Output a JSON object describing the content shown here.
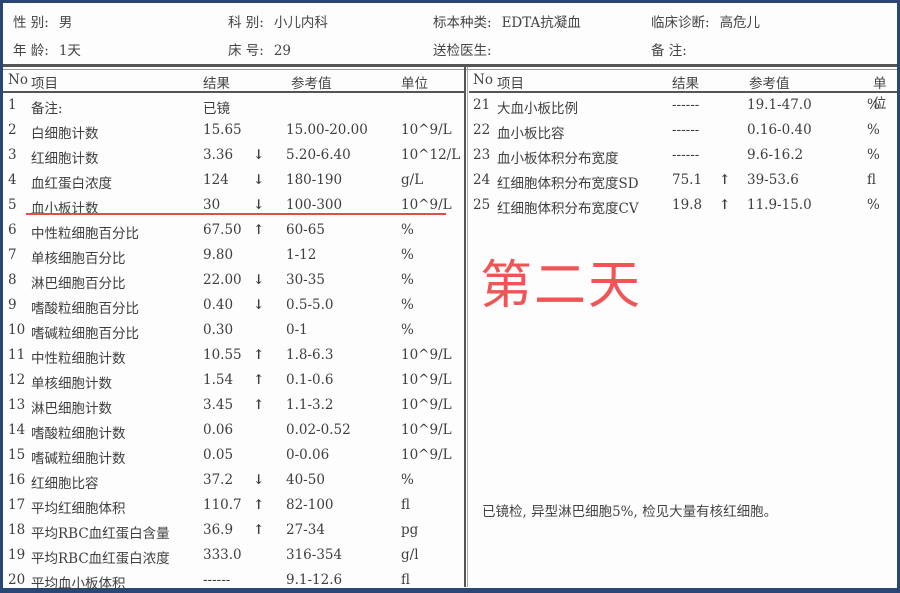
{
  "header": {
    "row1": [
      {
        "label": "性  别:",
        "value": "男"
      },
      {
        "label": "科  别:",
        "value": "小儿内科"
      },
      {
        "label": "标本种类:",
        "value": "EDTA抗凝血"
      },
      {
        "label": "临床诊断:",
        "value": "高危儿"
      }
    ],
    "row2": [
      {
        "label": "年  龄:",
        "value": "1天"
      },
      {
        "label": "床  号:",
        "value": "29"
      },
      {
        "label": "送检医生:",
        "value": ""
      },
      {
        "label": "备    注:",
        "value": ""
      }
    ]
  },
  "columns": {
    "no": "No",
    "name": "项目",
    "result": "结果",
    "reference": "参考值",
    "unit": "单位"
  },
  "left_rows": [
    {
      "no": "1",
      "name": "备注:",
      "result": "已镜",
      "flag": "",
      "reference": "",
      "unit": ""
    },
    {
      "no": "2",
      "name": "白细胞计数",
      "result": "15.65",
      "flag": "",
      "reference": "15.00-20.00",
      "unit": "10^9/L"
    },
    {
      "no": "3",
      "name": "红细胞计数",
      "result": "3.36",
      "flag": "↓",
      "reference": "5.20-6.40",
      "unit": "10^12/L"
    },
    {
      "no": "4",
      "name": "血红蛋白浓度",
      "result": "124",
      "flag": "↓",
      "reference": "180-190",
      "unit": "g/L"
    },
    {
      "no": "5",
      "name": "血小板计数",
      "result": "30",
      "flag": "↓",
      "reference": "100-300",
      "unit": "10^9/L"
    },
    {
      "no": "6",
      "name": "中性粒细胞百分比",
      "result": "67.50",
      "flag": "↑",
      "reference": "60-65",
      "unit": "%"
    },
    {
      "no": "7",
      "name": "单核细胞百分比",
      "result": "9.80",
      "flag": "",
      "reference": "1-12",
      "unit": "%"
    },
    {
      "no": "8",
      "name": "淋巴细胞百分比",
      "result": "22.00",
      "flag": "↓",
      "reference": "30-35",
      "unit": "%"
    },
    {
      "no": "9",
      "name": "嗜酸粒细胞百分比",
      "result": "0.40",
      "flag": "↓",
      "reference": "0.5-5.0",
      "unit": "%"
    },
    {
      "no": "10",
      "name": "嗜碱粒细胞百分比",
      "result": "0.30",
      "flag": "",
      "reference": "0-1",
      "unit": "%"
    },
    {
      "no": "11",
      "name": "中性粒细胞计数",
      "result": "10.55",
      "flag": "↑",
      "reference": "1.8-6.3",
      "unit": "10^9/L"
    },
    {
      "no": "12",
      "name": "单核细胞计数",
      "result": "1.54",
      "flag": "↑",
      "reference": "0.1-0.6",
      "unit": "10^9/L"
    },
    {
      "no": "13",
      "name": "淋巴细胞计数",
      "result": "3.45",
      "flag": "↑",
      "reference": "1.1-3.2",
      "unit": "10^9/L"
    },
    {
      "no": "14",
      "name": "嗜酸粒细胞计数",
      "result": "0.06",
      "flag": "",
      "reference": "0.02-0.52",
      "unit": "10^9/L"
    },
    {
      "no": "15",
      "name": "嗜碱粒细胞计数",
      "result": "0.05",
      "flag": "",
      "reference": "0-0.06",
      "unit": "10^9/L"
    },
    {
      "no": "16",
      "name": "红细胞比容",
      "result": "37.2",
      "flag": "↓",
      "reference": "40-50",
      "unit": "%"
    },
    {
      "no": "17",
      "name": "平均红细胞体积",
      "result": "110.7",
      "flag": "↑",
      "reference": "82-100",
      "unit": "fl"
    },
    {
      "no": "18",
      "name": "平均RBC血红蛋白含量",
      "result": "36.9",
      "flag": "↑",
      "reference": "27-34",
      "unit": "pg"
    },
    {
      "no": "19",
      "name": "平均RBC血红蛋白浓度",
      "result": "333.0",
      "flag": "",
      "reference": "316-354",
      "unit": "g/l"
    },
    {
      "no": "20",
      "name": "平均血小板体积",
      "result": "------",
      "flag": "",
      "reference": "9.1-12.6",
      "unit": "fl"
    }
  ],
  "right_rows": [
    {
      "no": "21",
      "name": "大血小板比例",
      "result": "------",
      "flag": "",
      "reference": "19.1-47.0",
      "unit": "%"
    },
    {
      "no": "22",
      "name": "血小板比容",
      "result": "------",
      "flag": "",
      "reference": "0.16-0.40",
      "unit": "%"
    },
    {
      "no": "23",
      "name": "血小板体积分布宽度",
      "result": "------",
      "flag": "",
      "reference": "9.6-16.2",
      "unit": "%"
    },
    {
      "no": "24",
      "name": "红细胞体积分布宽度SD",
      "result": "75.1",
      "flag": "↑",
      "reference": "39-53.6",
      "unit": "fl"
    },
    {
      "no": "25",
      "name": "红细胞体积分布宽度CV",
      "result": "19.8",
      "flag": "↑",
      "reference": "11.9-15.0",
      "unit": "%"
    }
  ],
  "annotation": {
    "day_label": "第二天",
    "highlight_color": "#e84a4a",
    "highlighted_row": "5"
  },
  "remark": "已镜检, 异型淋巴细胞5%, 检见大量有核红细胞。"
}
